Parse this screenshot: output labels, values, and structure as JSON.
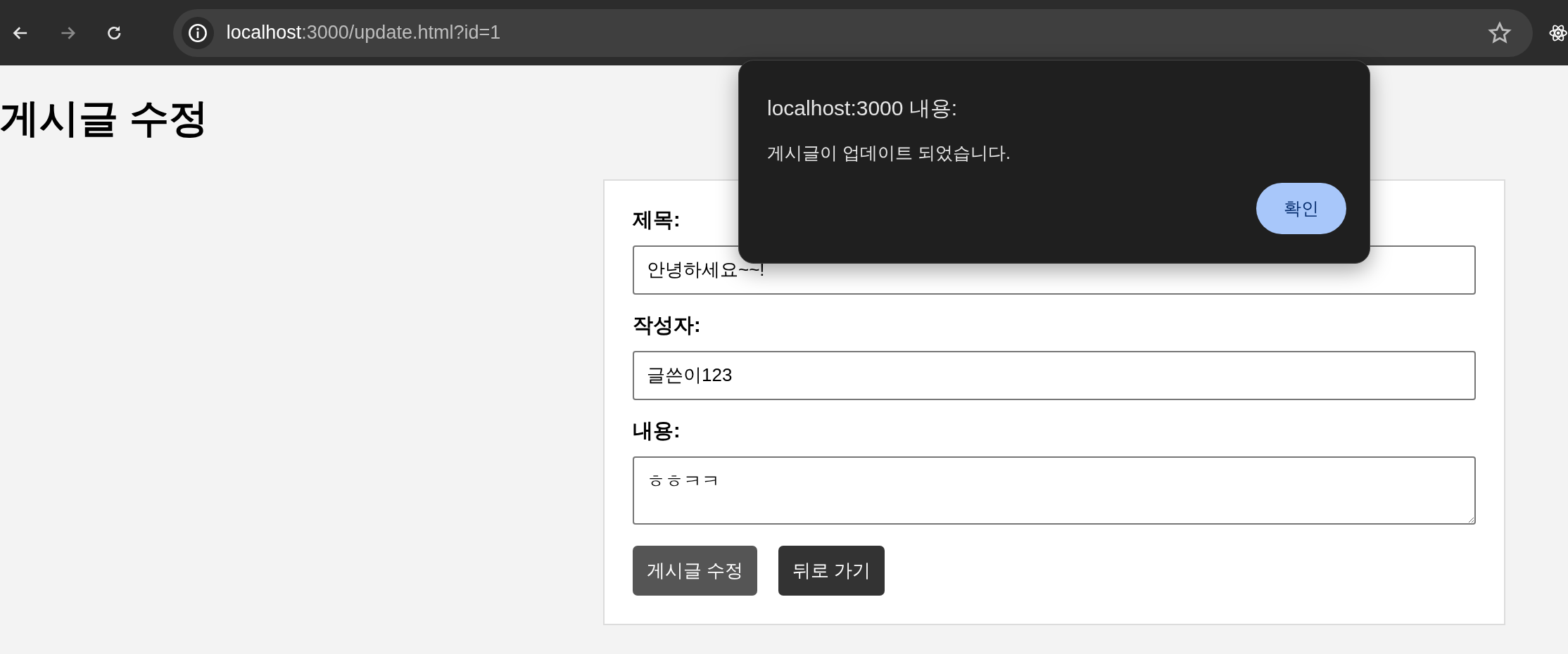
{
  "browser": {
    "url_host": "localhost",
    "url_path": ":3000/update.html?id=1",
    "forward_disabled": true
  },
  "page": {
    "heading": "게시글 수정",
    "fields": [
      {
        "kind": "input",
        "label": "제목:",
        "value": "안녕하세요~~!"
      },
      {
        "kind": "input",
        "label": "작성자:",
        "value": "글쓴이123"
      },
      {
        "kind": "textarea",
        "label": "내용:",
        "value": "ㅎㅎㅋㅋ"
      }
    ],
    "buttons": [
      {
        "kind": "submit",
        "label": "게시글 수정"
      },
      {
        "kind": "back",
        "label": "뒤로 가기"
      }
    ]
  },
  "dialog": {
    "title": "localhost:3000 내용:",
    "message": "게시글이 업데이트 되었습니다.",
    "button": "확인"
  }
}
